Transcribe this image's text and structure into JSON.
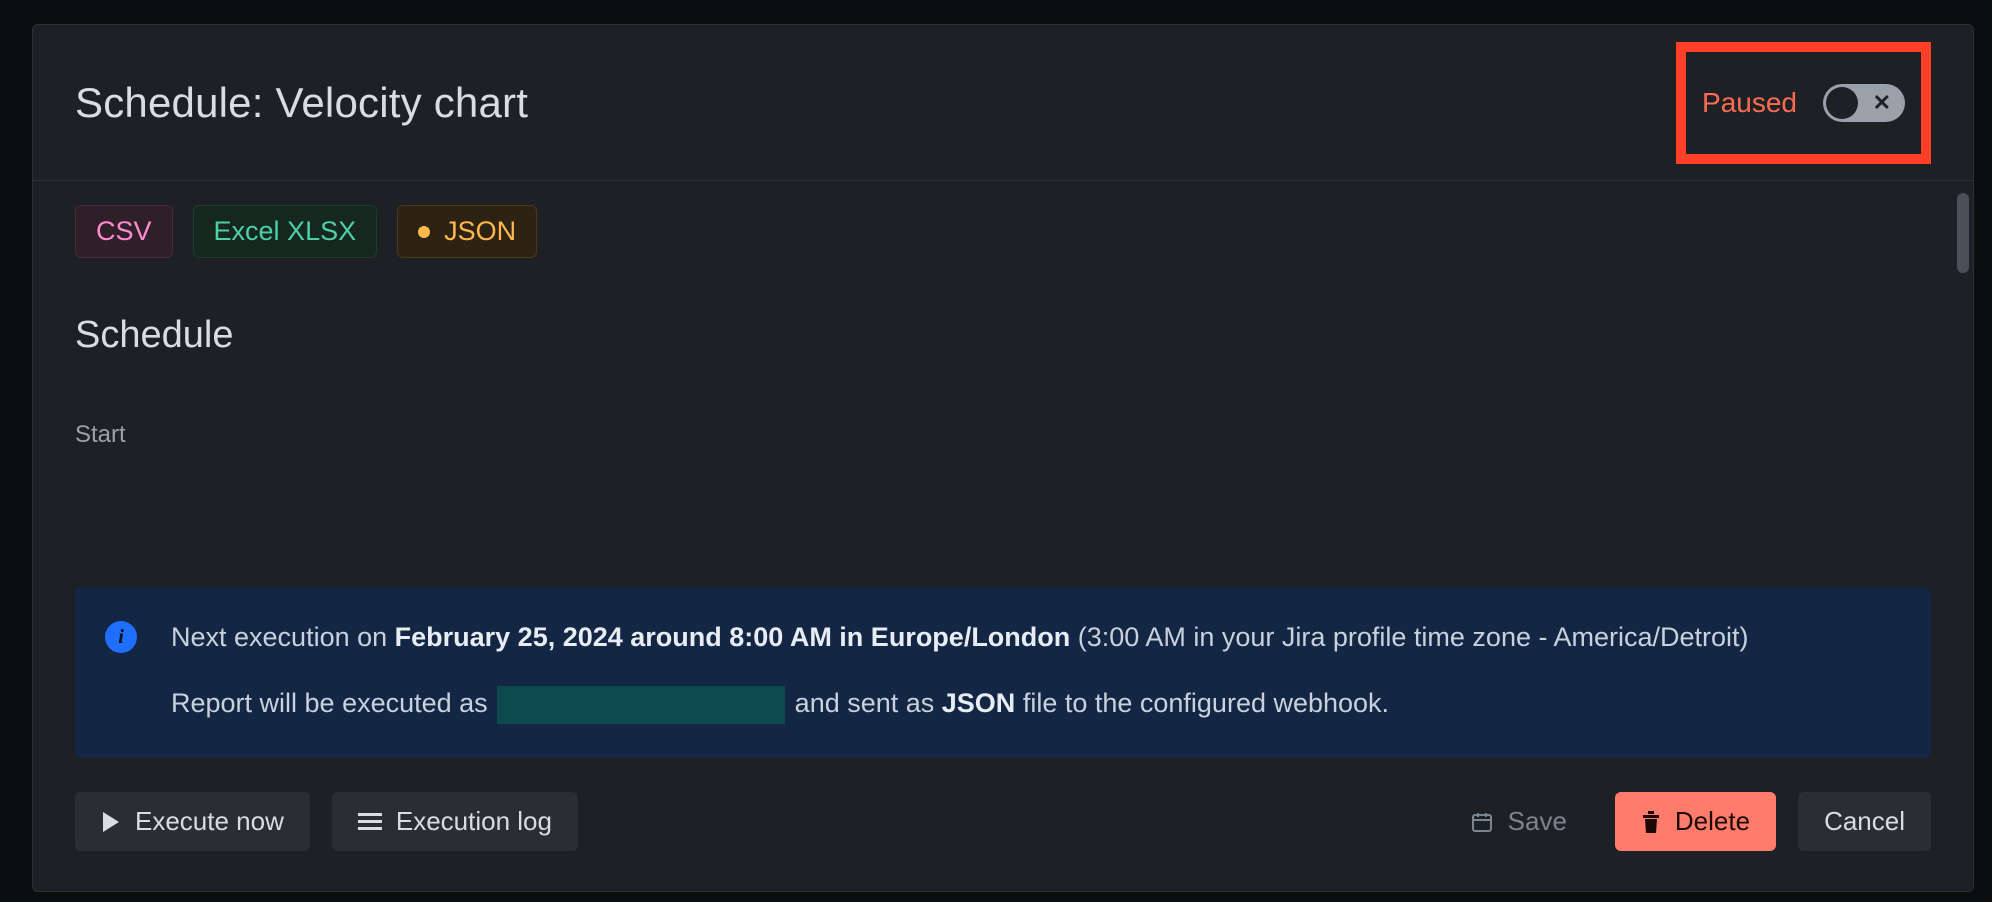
{
  "header": {
    "title": "Schedule: Velocity chart",
    "status_label": "Paused"
  },
  "formats": {
    "csv": "CSV",
    "excel": "Excel XLSX",
    "json": "JSON"
  },
  "section": {
    "schedule_heading": "Schedule",
    "start_label": "Start"
  },
  "info": {
    "line1_prefix": "Next execution on ",
    "line1_bold": "February 25, 2024 around 8:00 AM in Europe/London",
    "line1_suffix": " (3:00 AM in your Jira profile time zone - America/Detroit)",
    "line2_prefix": "Report will be executed as ",
    "line2_mid": " and sent as ",
    "line2_bold": "JSON",
    "line2_suffix": " file to the configured webhook."
  },
  "buttons": {
    "execute_now": "Execute now",
    "execution_log": "Execution log",
    "save": "Save",
    "delete": "Delete",
    "cancel": "Cancel"
  }
}
